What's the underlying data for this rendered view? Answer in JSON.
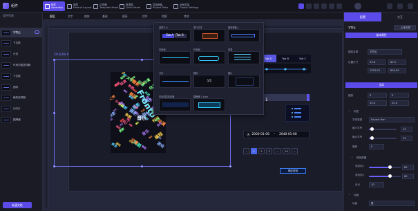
{
  "app": {
    "title": "组件"
  },
  "toolbar": {
    "items": [
      {
        "label": "组件\nAssembly",
        "active": true
      },
      {
        "label": "图层\nDefault Layout",
        "active": false
      },
      {
        "label": "过滤器\nTemplate Panel",
        "active": false
      },
      {
        "label": "数据源\nQuick Panel",
        "active": false
      },
      {
        "label": "层级面板\nProject Data",
        "active": false
      },
      {
        "label": "全局变量\nGlobal Settings",
        "active": false
      }
    ]
  },
  "sidebar": {
    "header": "组件列表",
    "items": [
      {
        "label": "字符云",
        "selected": true
      },
      {
        "label": "下拉框"
      },
      {
        "label": "分页"
      },
      {
        "label": "时间范围选择器"
      },
      {
        "label": "下拉框"
      },
      {
        "label": "图标"
      },
      {
        "label": "横条选择器"
      },
      {
        "label": "幻灯片"
      },
      {
        "label": "翻牌器"
      }
    ],
    "bottom_button": "新建文档"
  },
  "canvas_tabs": [
    "图层",
    "文字",
    "媒体",
    "基础",
    "图表",
    "控件",
    "地图",
    "其他"
  ],
  "canvas": {
    "coord_label": "29.8,69.9",
    "wordcloud": {
      "center": "音乐",
      "big": "Fronto"
    },
    "tabs": [
      "Tab A",
      "Tab B",
      "Tab C"
    ],
    "fraction": "/ 1",
    "date_start": "2000-01-06",
    "date_end": "2040-01-00",
    "pager": [
      "‹",
      "1",
      "2",
      "3",
      "...",
      "10",
      "›"
    ],
    "pager_active": "1",
    "button_label": "确定按钮"
  },
  "panel": {
    "cells": [
      {
        "label": "选项卡 A",
        "content": "Tab A | Tab B"
      },
      {
        "label": "单行文本",
        "content": ""
      },
      {
        "label": "搜索框输入",
        "content": ""
      },
      {
        "label": "时间轴",
        "content": ""
      },
      {
        "label": "时间轴",
        "content": ""
      },
      {
        "label": "列表",
        "content": ""
      },
      {
        "label": "分页",
        "content": ""
      },
      {
        "label": "翻页",
        "content": "1/1"
      },
      {
        "label": "图片",
        "content": ""
      },
      {
        "label": "时间范围选择器",
        "content": ""
      },
      {
        "label": "翻牌器 1 style",
        "content": ""
      }
    ]
  },
  "right_panel": {
    "tabs": [
      {
        "label": "配置",
        "active": true
      },
      {
        "label": "交互",
        "active": false
      }
    ],
    "name_label": "字符云",
    "upload_label": "上传文件",
    "section1": "基本属性",
    "fields": [
      {
        "label": "图层名称",
        "value": "字符云"
      },
      {
        "label": "位置尺寸",
        "value": "29.8"
      },
      {
        "label": "",
        "value": "69.9"
      },
      {
        "label": "",
        "value": "1313.00"
      },
      {
        "label": "",
        "value": "800.00"
      }
    ],
    "section2": "全局",
    "global_fields": [
      {
        "label": "缩放",
        "value": "0"
      },
      {
        "label": "",
        "value": "0"
      },
      {
        "label": "",
        "value": "25.0"
      },
      {
        "label": "",
        "value": "25.0"
      }
    ],
    "style_header": "标签",
    "font_label": "字体类型",
    "font_value": "Source Han",
    "font_min_label": "最小字号",
    "font_min_value": "12",
    "font_max_label": "最大字号",
    "font_max_value": "12",
    "rotate_label": "旋转",
    "rotate_value": "0",
    "color_header": "颜色配置",
    "c1_label": "渐变色1",
    "c1_value": "80",
    "c2_label": "渐变色2",
    "c2_value": "80",
    "step_label": "步长",
    "step_value": "10",
    "anim_header": "动画",
    "anim_label": "动画",
    "anim_value": "是"
  },
  "colors": {
    "accent": "#5b4be8",
    "stage": "#1b1c29",
    "selection": "#6a6ee8"
  }
}
